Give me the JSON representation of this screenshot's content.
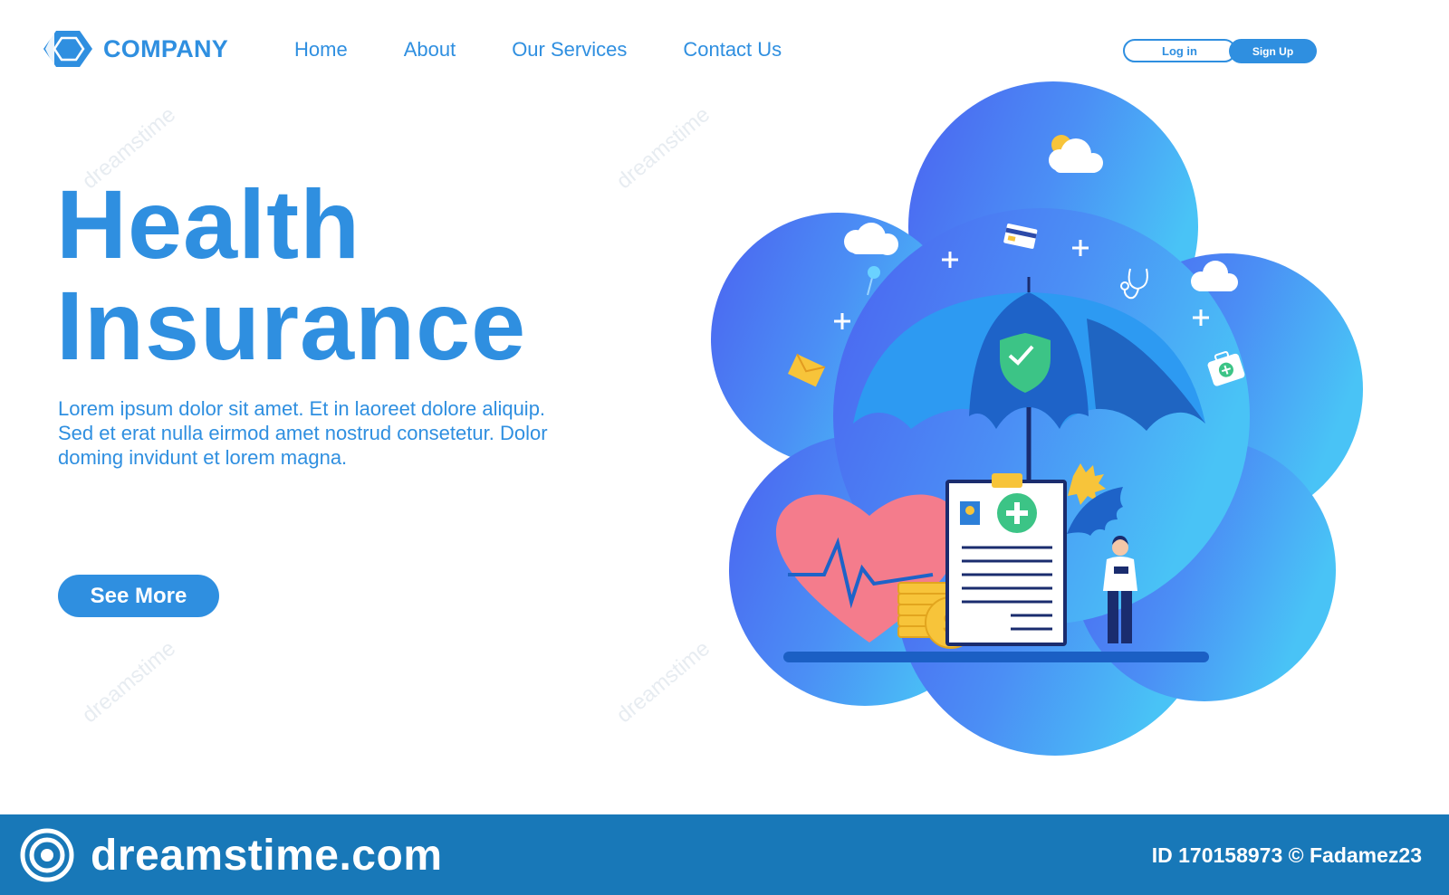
{
  "brand": {
    "name": "COMPANY",
    "icon": "hexagon-logo-icon",
    "color": "#2f8fe0"
  },
  "nav": {
    "items": [
      "Home",
      "About",
      "Our Services",
      "Contact Us"
    ]
  },
  "auth": {
    "login_label": "Log in",
    "signup_label": "Sign Up"
  },
  "hero": {
    "title_line1": "Health",
    "title_line2": "Insurance",
    "description": "Lorem ipsum dolor sit amet. Et in laoreet dolore aliquip. Sed et erat nulla eirmod amet nostrud consetetur. Dolor doming invidunt et lorem magna.",
    "cta_label": "See More"
  },
  "illustration": {
    "icons": [
      "cloud-icon",
      "credit-card-icon",
      "stethoscope-icon",
      "pin-icon",
      "envelope-icon",
      "first-aid-kit-icon",
      "umbrella-icon",
      "shield-check-icon",
      "heart-pulse-icon",
      "coins-icon",
      "dollar-coin-icon",
      "medical-document-icon",
      "doctor-figure-icon",
      "leaf-icon",
      "plus-icon"
    ]
  },
  "watermark": {
    "domain": "dreamstime.com",
    "id_text": "ID 170158973 © Fadamez23",
    "bg_color": "#1878b8"
  }
}
